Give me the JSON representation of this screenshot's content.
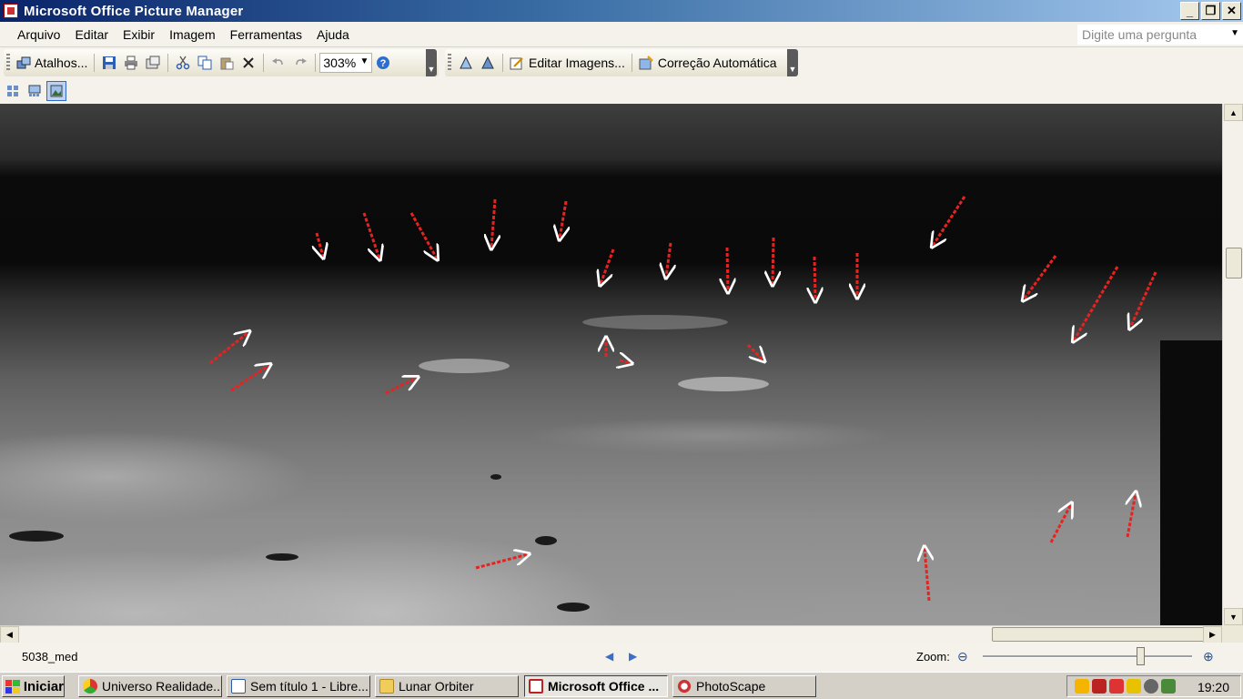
{
  "window": {
    "title": "Microsoft Office Picture Manager",
    "buttons": [
      "_",
      "▫",
      "✕"
    ]
  },
  "menu": {
    "items": [
      "Arquivo",
      "Editar",
      "Exibir",
      "Imagem",
      "Ferramentas",
      "Ajuda"
    ],
    "ask_placeholder": "Digite uma pergunta"
  },
  "toolbar": {
    "shortcuts_label": "Atalhos...",
    "zoom_value": "303%",
    "edit_images_label": "Editar Imagens...",
    "auto_correct_label": "Correção Automática"
  },
  "status": {
    "filename": "5038_med",
    "zoom_label": "Zoom:",
    "zoom_slider_fraction": 0.75
  },
  "taskbar": {
    "start_label": "Iniciar",
    "tasks": [
      {
        "label": "Universo Realidade...",
        "icon": "chrome-icon"
      },
      {
        "label": "Sem título 1 - Libre...",
        "icon": "writer-icon"
      },
      {
        "label": "Lunar Orbiter",
        "icon": "folder-icon"
      },
      {
        "label": "Microsoft Office ...",
        "icon": "picture-manager-icon"
      },
      {
        "label": "PhotoScape",
        "icon": "photoscape-icon"
      }
    ],
    "clock": "19:20"
  },
  "colors": {
    "arrow": "#e8231f",
    "titlebar_start": "#0a246a",
    "titlebar_end": "#a6caf0"
  }
}
